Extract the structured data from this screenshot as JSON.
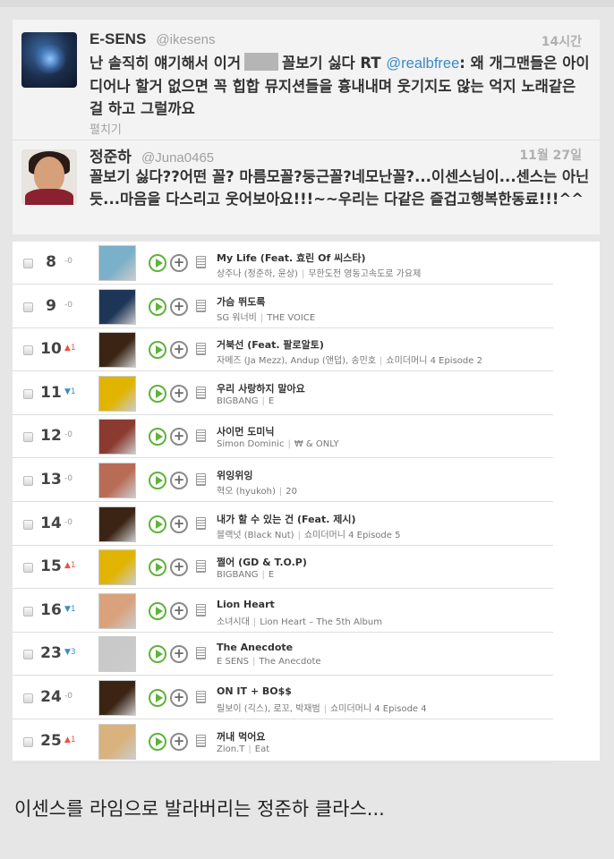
{
  "tweets": [
    {
      "name": "E-SENS",
      "handle": "@ikesens",
      "time": "14시간",
      "text_part1": "난 솔직히 얘기해서 이거",
      "text_part2": "꼴보기 싫다 RT",
      "mention": "@realbfree",
      "text_part3": ": 왜 개그맨들은 아이디어나 할거 없으면 꼭 힙합 뮤지션들을 흉내내며 웃기지도 않는 억지 노래같은 걸 하고 그럴까요",
      "expand_label": "펼치기"
    },
    {
      "name": "정준하",
      "handle": "@Juna0465",
      "time": "11월 27일",
      "text": "꼴보기 싫다??어떤 꼴? 마름모꼴?둥근꼴?네모난꼴?...이센스님이...센스는 아닌듯...마음을 다스리고 웃어보아요!!!~~우리는 다같은 즐겁고행복한동료!!!^^"
    }
  ],
  "chart_rows": [
    {
      "rank": "8",
      "change": "-0",
      "dir": "same",
      "title": "My Life (Feat. 효린 Of 씨스타)",
      "artist": "상주나 (정준하, 윤상)",
      "album": "무한도전 영동고속도로 가요제",
      "art": "#7ab0c9"
    },
    {
      "rank": "9",
      "change": "-0",
      "dir": "same",
      "title": "가슴 뛰도록",
      "artist": "SG 워너비",
      "album": "THE VOICE",
      "art": "#1d3557"
    },
    {
      "rank": "10",
      "change": "▲1",
      "dir": "up",
      "title": "거북선 (Feat. 팔로알토)",
      "artist": "자메즈 (Ja Mezz), Andup (앤덥), 송민호",
      "album": "쇼미더머니 4 Episode 2",
      "art": "#3b2414"
    },
    {
      "rank": "11",
      "change": "▼1",
      "dir": "down",
      "title": "우리 사랑하지 말아요",
      "artist": "BIGBANG",
      "album": "E",
      "art": "#e0b400"
    },
    {
      "rank": "12",
      "change": "-0",
      "dir": "same",
      "title": "사이먼 도미닉",
      "artist": "Simon Dominic",
      "album": "₩ & ONLY",
      "art": "#8a3a2e"
    },
    {
      "rank": "13",
      "change": "-0",
      "dir": "same",
      "title": "위잉위잉",
      "artist": "혁오 (hyukoh)",
      "album": "20",
      "art": "#b86b55"
    },
    {
      "rank": "14",
      "change": "-0",
      "dir": "same",
      "title": "내가 할 수 있는 건 (Feat. 제시)",
      "artist": "블랙넛 (Black Nut)",
      "album": "쇼미더머니 4 Episode 5",
      "art": "#3b2414"
    },
    {
      "rank": "15",
      "change": "▲1",
      "dir": "up",
      "title": "쩔어 (GD & T.O.P)",
      "artist": "BIGBANG",
      "album": "E",
      "art": "#e0b400"
    },
    {
      "rank": "16",
      "change": "▼1",
      "dir": "down",
      "title": "Lion Heart",
      "artist": "소녀시대",
      "album": "Lion Heart – The 5th Album",
      "art": "#d9a27d"
    },
    {
      "rank": "23",
      "change": "▼3",
      "dir": "down",
      "title": "The Anecdote",
      "artist": "E SENS",
      "album": "The Anecdote",
      "art": "#c9c9c9"
    },
    {
      "rank": "24",
      "change": "-0",
      "dir": "same",
      "title": "ON IT + BO$$",
      "artist": "릴보이 (긱스), 로꼬, 박재범",
      "album": "쇼미더머니 4 Episode 4",
      "art": "#3b2414"
    },
    {
      "rank": "25",
      "change": "▲1",
      "dir": "up",
      "title": "꺼내 먹어요",
      "artist": "Zion.T",
      "album": "Eat",
      "art": "#d9b27d"
    }
  ],
  "caption": "이센스를 라임으로 발라버리는 정준하 클라스...",
  "colors": {
    "play_green": "#5fb33a",
    "mention_blue": "#3a8bc6",
    "rank_up": "#e8534a",
    "rank_down": "#3a8fbf"
  }
}
